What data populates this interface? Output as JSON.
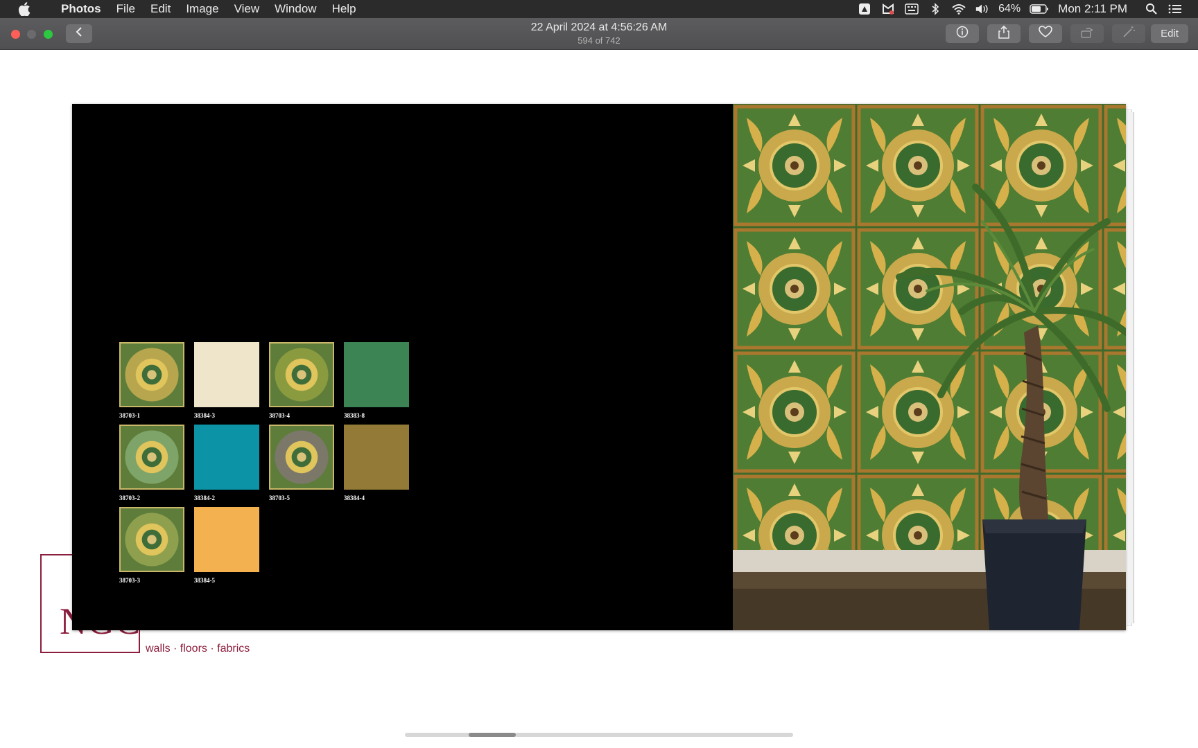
{
  "menubar": {
    "app": "Photos",
    "items": [
      "File",
      "Edit",
      "Image",
      "View",
      "Window",
      "Help"
    ],
    "battery": "64%",
    "clock": "Mon 2:11 PM",
    "icons": [
      "apple-icon",
      "screen-capture-icon",
      "mail-shield-icon",
      "keyboard-icon",
      "bluetooth-icon",
      "wifi-icon",
      "volume-icon",
      "battery-icon",
      "spotlight-search-icon",
      "control-center-icon"
    ]
  },
  "toolbar": {
    "title": "22 April 2024 at 4:56:26 AM",
    "subtitle": "594 of 742",
    "edit_label": "Edit",
    "buttons": [
      "info-icon",
      "share-icon",
      "favorite-heart-icon",
      "rotate-icon",
      "enhance-wand-icon"
    ]
  },
  "catalog": {
    "swatches": [
      {
        "code": "38703-1",
        "color": "#b7a64e",
        "pattern": true
      },
      {
        "code": "38384-3",
        "color": "#efe5ca",
        "pattern": false
      },
      {
        "code": "38703-4",
        "color": "#8a9b3f",
        "pattern": true
      },
      {
        "code": "38383-8",
        "color": "#3d8454",
        "pattern": false
      },
      {
        "code": "38703-2",
        "color": "#7ea46a",
        "pattern": true
      },
      {
        "code": "38384-2",
        "color": "#0c94a6",
        "pattern": false
      },
      {
        "code": "38703-5",
        "color": "#7b786a",
        "pattern": true
      },
      {
        "code": "38384-4",
        "color": "#937a37",
        "pattern": false
      },
      {
        "code": "38703-3",
        "color": "#8ea04e",
        "pattern": true
      },
      {
        "code": "38384-5",
        "color": "#f3b24f",
        "pattern": false
      }
    ]
  },
  "brand": {
    "logo": "NGC",
    "tagline": "walls · floors · fabrics"
  },
  "colors": {
    "menubar_bg": "#2b2b2c",
    "toolbar_bg": "#555557",
    "brand": "#8c1d3c",
    "close": "#ff5f57",
    "zoom": "#2bc840"
  }
}
